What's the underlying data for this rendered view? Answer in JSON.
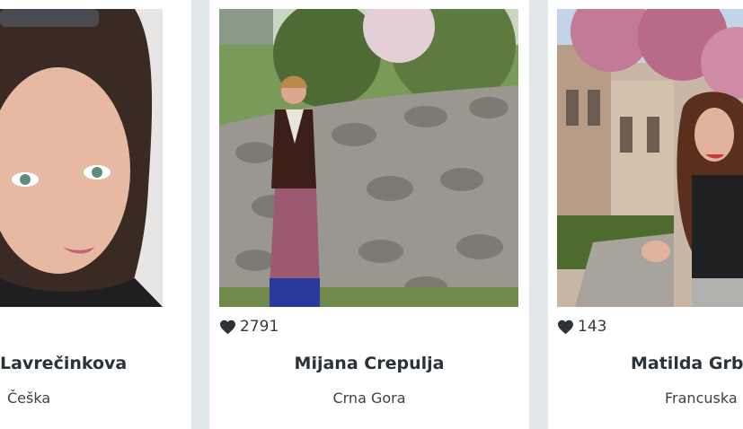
{
  "cards": [
    {
      "name": "Lavrečinkova",
      "country": "Češka",
      "likes": ""
    },
    {
      "name": "Mijana Crepulja",
      "country": "Crna Gora",
      "likes": "2791"
    },
    {
      "name": "Matilda Grb",
      "country": "Francuska",
      "likes": "143"
    }
  ],
  "icons": {
    "like": "heart-icon"
  },
  "colors": {
    "heart": "#2c3338",
    "page_bg": "#e2e8ea"
  }
}
